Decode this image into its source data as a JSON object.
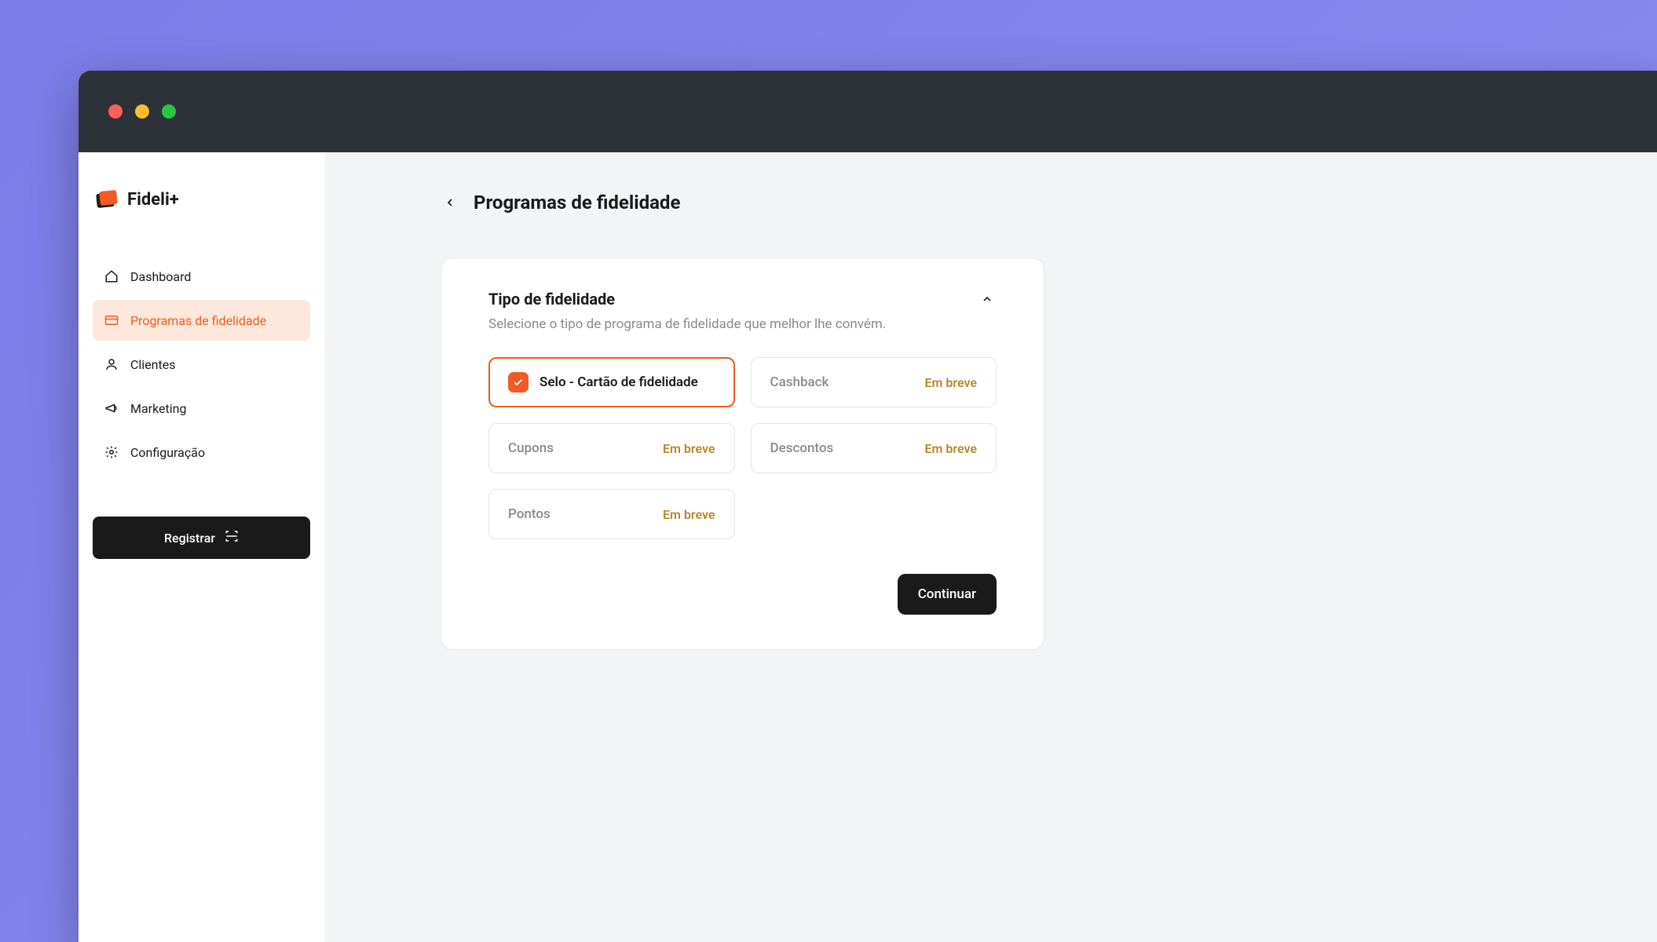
{
  "brand": {
    "name": "Fideli+"
  },
  "sidebar": {
    "items": [
      {
        "label": "Dashboard",
        "icon": "home"
      },
      {
        "label": "Programas de fidelidade",
        "icon": "card",
        "active": true
      },
      {
        "label": "Clientes",
        "icon": "user"
      },
      {
        "label": "Marketing",
        "icon": "megaphone"
      },
      {
        "label": "Configuração",
        "icon": "gear"
      }
    ],
    "register_label": "Registrar"
  },
  "page": {
    "title": "Programas de fidelidade"
  },
  "card": {
    "title": "Tipo de fidelidade",
    "subtitle": "Selecione o tipo de programa de fidelidade que melhor lhe convém.",
    "options": [
      {
        "label": "Selo - Cartão de fidelidade",
        "selected": true,
        "badge": null
      },
      {
        "label": "Cashback",
        "selected": false,
        "badge": "Em breve"
      },
      {
        "label": "Cupons",
        "selected": false,
        "badge": "Em breve"
      },
      {
        "label": "Descontos",
        "selected": false,
        "badge": "Em breve"
      },
      {
        "label": "Pontos",
        "selected": false,
        "badge": "Em breve"
      }
    ],
    "continue_label": "Continuar"
  }
}
